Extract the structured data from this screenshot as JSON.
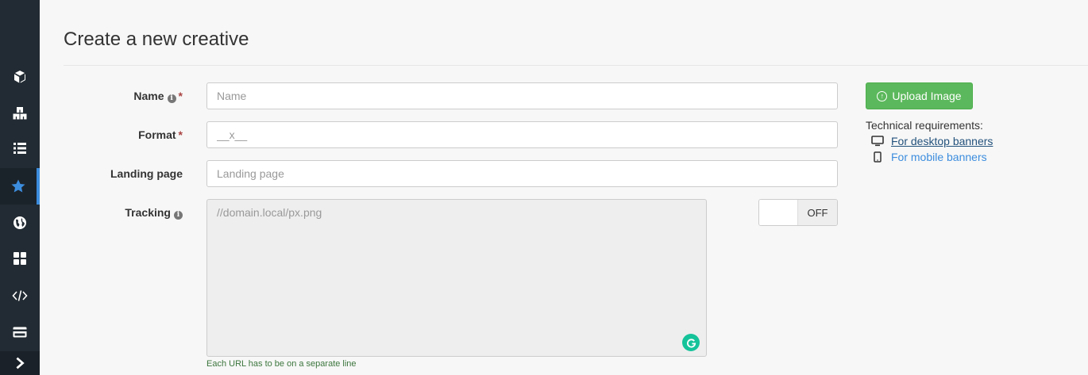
{
  "page": {
    "title": "Create a new creative"
  },
  "sidebar": {
    "items": [
      {
        "name": "cube-icon"
      },
      {
        "name": "cubes-icon"
      },
      {
        "name": "list-icon"
      },
      {
        "name": "star-icon",
        "active": true
      },
      {
        "name": "globe-icon"
      },
      {
        "name": "grid-icon"
      },
      {
        "name": "code-icon"
      },
      {
        "name": "credit-card-icon"
      },
      {
        "name": "chevron-right-icon"
      }
    ],
    "accent": "#3c8dde"
  },
  "form": {
    "name": {
      "label": "Name",
      "required": "*",
      "placeholder": "Name",
      "value": ""
    },
    "format": {
      "label": "Format",
      "required": "*",
      "placeholder": "__x__",
      "value": ""
    },
    "landing": {
      "label": "Landing page",
      "placeholder": "Landing page",
      "value": ""
    },
    "tracking": {
      "label": "Tracking",
      "placeholder": "//domain.local/px.png",
      "value": "",
      "help": "Each URL has to be on a separate line",
      "toggle_state": "OFF"
    }
  },
  "upload": {
    "label": "Upload Image",
    "color": "#5cb85c"
  },
  "technical": {
    "heading": "Technical requirements:",
    "desktop": "For desktop banners",
    "mobile": "For mobile banners"
  }
}
